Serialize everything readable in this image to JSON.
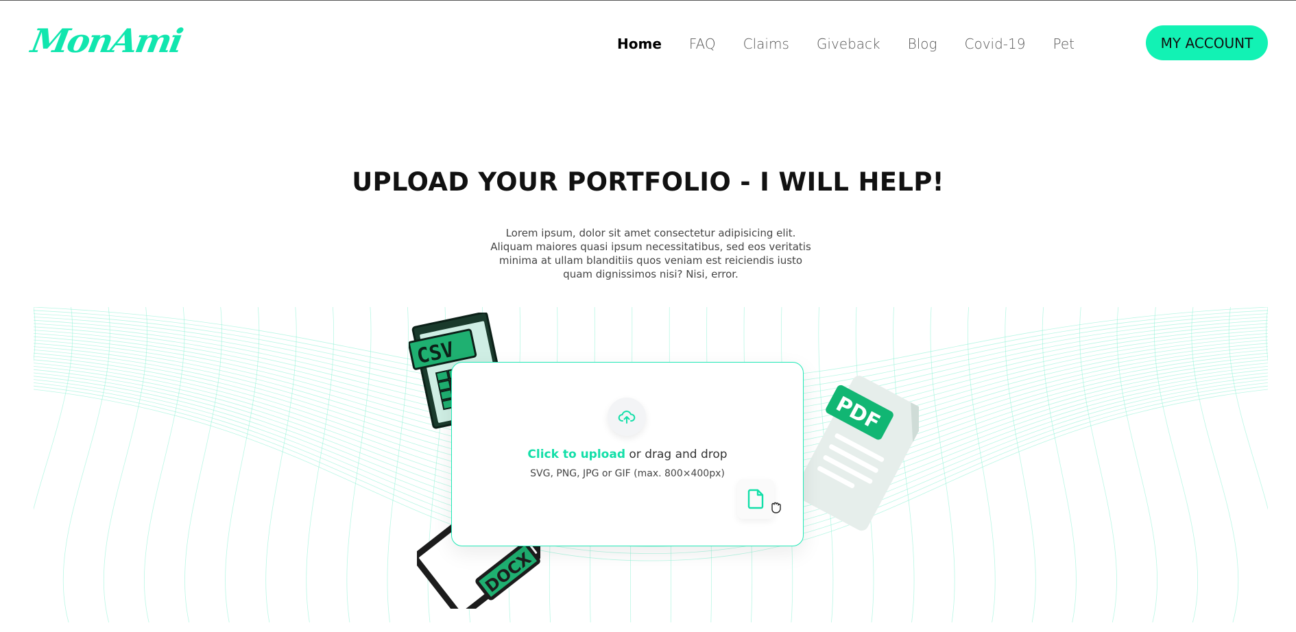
{
  "brand": {
    "logo_text": "MonAmi",
    "accent": "#12f2b4"
  },
  "nav": {
    "items": [
      {
        "label": "Home",
        "active": true
      },
      {
        "label": "FAQ",
        "active": false
      },
      {
        "label": "Claims",
        "active": false
      },
      {
        "label": "Giveback",
        "active": false
      },
      {
        "label": "Blog",
        "active": false
      },
      {
        "label": "Covid-19",
        "active": false
      },
      {
        "label": "Pet",
        "active": false
      }
    ],
    "account_label": "MY ACCOUNT"
  },
  "hero": {
    "title": "UPLOAD YOUR PORTFOLIO - I WILL HELP!",
    "description": "Lorem ipsum, dolor sit amet consectetur adipisicing elit. Aliquam maiores quasi ipsum necessitatibus, sed eos veritatis minima at ullam blanditiis quos veniam est reiciendis iusto quam dignissimos nisi? Nisi, error."
  },
  "upload": {
    "link_text": "Click to upload",
    "rest_text": " or drag and drop",
    "hint": "SVG, PNG, JPG or GIF (max. 800×400px)",
    "icon": "cloud-upload-icon",
    "file_icon": "file-icon"
  },
  "deco_files": {
    "csv_label": "CSV",
    "pdf_label": "PDF",
    "docx_label": "DOCX"
  }
}
